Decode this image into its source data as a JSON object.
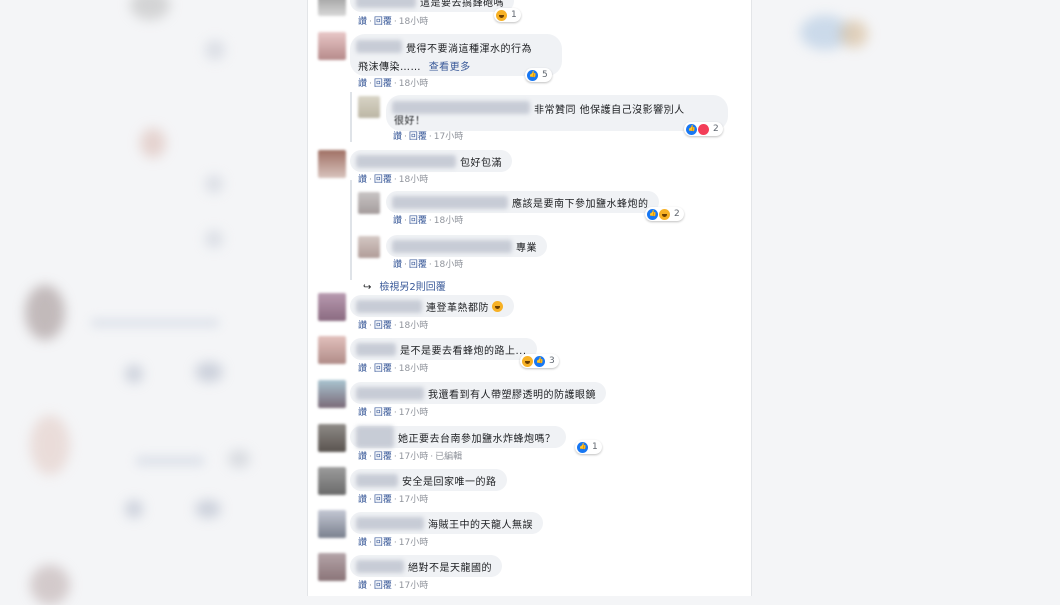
{
  "actions": {
    "like": "讚",
    "reply": "回覆",
    "edited": "已編輯",
    "dot": "·"
  },
  "comments": [
    {
      "id": "c0",
      "text": "這是要去搞鋒砲嗎",
      "time": "18小時",
      "reactions": "1"
    },
    {
      "id": "c1",
      "text": "覺得不要淌這種渾水的行為",
      "text2": "飛沫傳染……",
      "see_more": "查看更多",
      "time": "18小時",
      "reactions": "5"
    },
    {
      "id": "c2",
      "text": "非常贊同 他保護自己沒影響別人",
      "text2": "很好！",
      "time": "17小時",
      "reactions": "2"
    },
    {
      "id": "c3",
      "text": "包好包滿",
      "time": "18小時"
    },
    {
      "id": "c4",
      "text": "應該是要南下參加鹽水蜂炮的",
      "time": "18小時",
      "reactions": "2"
    },
    {
      "id": "c5",
      "text": "專業",
      "time": "18小時"
    },
    {
      "id": "c6",
      "text": "連登革熱都防",
      "time": "18小時"
    },
    {
      "id": "c7",
      "text": "是不是要去看蜂炮的路上...",
      "time": "18小時",
      "reactions": "3"
    },
    {
      "id": "c8",
      "text": "我還看到有人帶塑膠透明的防護眼鏡",
      "time": "17小時"
    },
    {
      "id": "c9",
      "text": "她正要去台南參加鹽水炸蜂炮嗎？",
      "time": "17小時",
      "reactions": "1"
    },
    {
      "id": "c10",
      "text": "安全是回家唯一的路",
      "time": "17小時"
    },
    {
      "id": "c11",
      "text": "海賊王中的天龍人無誤",
      "time": "17小時"
    },
    {
      "id": "c12",
      "text": "絕對不是天龍國的",
      "time": "17小時"
    }
  ],
  "view_more_replies": "檢視另2則回覆",
  "colors": {
    "link": "#385898",
    "bubble": "#f0f2f5",
    "meta_gray": "#90949c",
    "like_blue": "#1877f2"
  },
  "icons": [
    "like-reaction-icon",
    "haha-reaction-icon",
    "love-reaction-icon",
    "reply-arrow-icon"
  ]
}
